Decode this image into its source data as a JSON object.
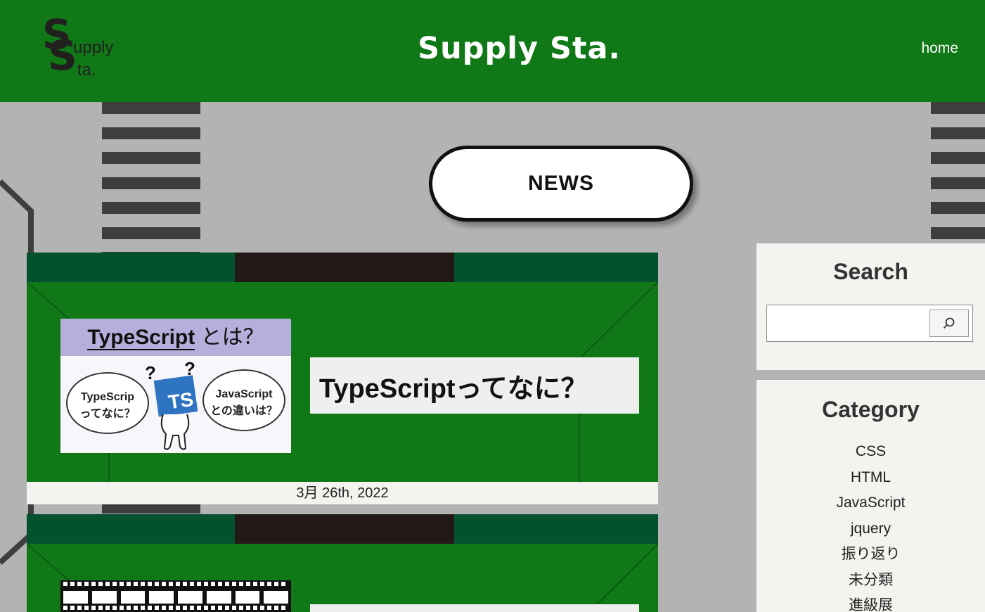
{
  "header": {
    "logo": {
      "letter": "S",
      "line1": "upply",
      "line2": "ta."
    },
    "site_title": "Supply Sta.",
    "nav_home": "home"
  },
  "section_title": "NEWS",
  "posts": [
    {
      "title": "TypeScriptってなに？",
      "date": "3月 26th, 2022",
      "thumbnail": {
        "heading_word": "TypeScript",
        "heading_suffix": " とは？",
        "left_bubble_line1": "TypeScrip",
        "left_bubble_line2": "ってなに？",
        "badge": "TS",
        "right_bubble_line1": "JavaScript",
        "right_bubble_line2": "との違いは？",
        "question_mark": "?"
      }
    },
    {
      "title": "",
      "date": "",
      "thumbnail": {
        "type": "film-strip"
      }
    }
  ],
  "sidebar": {
    "search": {
      "heading": "Search",
      "placeholder": "",
      "button_icon": "search-icon"
    },
    "category": {
      "heading": "Category",
      "items": [
        "CSS",
        "HTML",
        "JavaScript",
        "jquery",
        "振り返り",
        "未分類",
        "進級展"
      ]
    }
  },
  "colors": {
    "header_green": "#117817",
    "roof_dark_green": "#04522d",
    "roof_dark_brown": "#221917",
    "road_gray": "#b3b3b3",
    "stripe_gray": "#3e3e3e",
    "panel_bg": "#f3f3ef",
    "ts_blue": "#2f74c0",
    "thumb_header_lavender": "#b5b0db"
  }
}
